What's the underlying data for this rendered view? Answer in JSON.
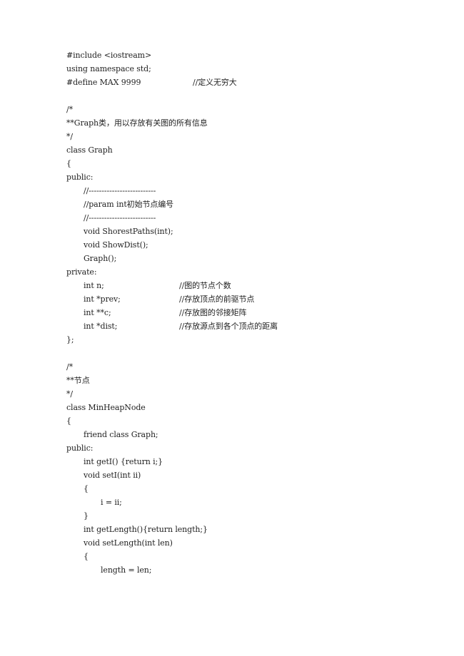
{
  "document": {
    "lines": [
      {
        "text": "#include <iostream>"
      },
      {
        "text": "using namespace std;"
      },
      {
        "text": "#define MAX 9999",
        "comment": "//定义无穷大"
      },
      {
        "text": ""
      },
      {
        "text": "/*"
      },
      {
        "text": "**Graph类，用以存放有关图的所有信息"
      },
      {
        "text": "*/"
      },
      {
        "text": "class Graph"
      },
      {
        "text": "{"
      },
      {
        "text": "public:"
      },
      {
        "text": "//--------------------------"
      },
      {
        "text": "//param int初始节点编号"
      },
      {
        "text": "//--------------------------"
      },
      {
        "text": "void ShorestPaths(int);"
      },
      {
        "text": "void ShowDist();"
      },
      {
        "text": "Graph();"
      },
      {
        "text": "private:"
      },
      {
        "text": "int n;",
        "comment": "//图的节点个数"
      },
      {
        "text": "int *prev;",
        "comment": "//存放顶点的前驱节点"
      },
      {
        "text": "int **c;",
        "comment": "//存放图的邻接矩阵"
      },
      {
        "text": "int *dist;",
        "comment": "//存放源点到各个顶点的距离"
      },
      {
        "text": "};"
      },
      {
        "text": ""
      },
      {
        "text": "/*"
      },
      {
        "text": "**节点"
      },
      {
        "text": "*/"
      },
      {
        "text": "class MinHeapNode"
      },
      {
        "text": "{"
      },
      {
        "text": "friend class Graph;"
      },
      {
        "text": "public:"
      },
      {
        "text": "int getI() {return i;}"
      },
      {
        "text": "void setI(int ii)"
      },
      {
        "text": "{"
      },
      {
        "text": "i = ii;"
      },
      {
        "text": "}"
      },
      {
        "text": "int getLength(){return length;}"
      },
      {
        "text": "void setLength(int len)"
      },
      {
        "text": "{"
      },
      {
        "text": "length = len;"
      }
    ]
  }
}
